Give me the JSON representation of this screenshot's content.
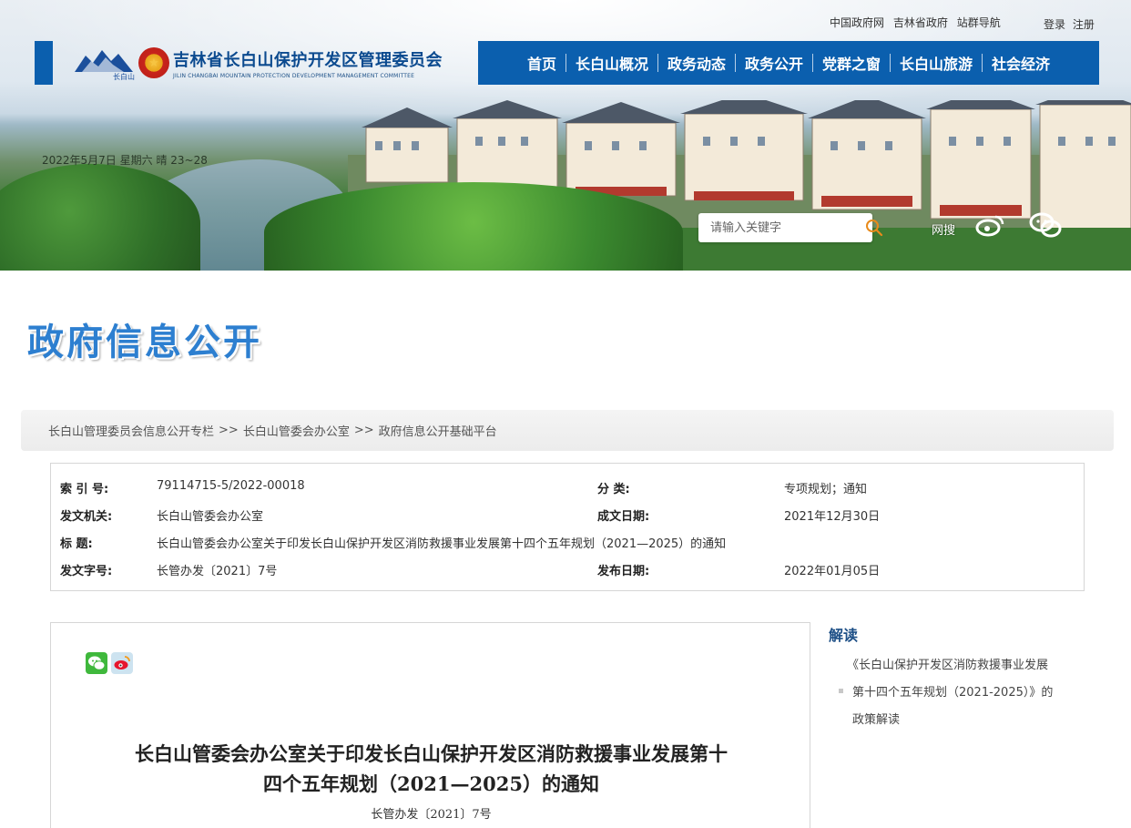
{
  "header": {
    "top_links": [
      "中国政府网",
      "吉林省政府",
      "站群导航"
    ],
    "auth_links": [
      "登录",
      "注册"
    ],
    "site_title": "吉林省长白山保护开发区管理委员会",
    "site_subtitle": "JILIN CHANGBAI MOUNTAIN PROTECTION DEVELOPMENT MANAGEMENT COMMITTEE",
    "logo_text": "长白山",
    "nav": [
      "首页",
      "长白山概况",
      "政务动态",
      "政务公开",
      "党群之窗",
      "长白山旅游",
      "社会经济"
    ],
    "date_text": "2022年5月7日 星期六 晴 23~28",
    "search_placeholder": "请输入关键字",
    "wangsou_label": "网搜",
    "accent_color": "#0b5fae"
  },
  "section_title": "政府信息公开",
  "breadcrumb": [
    "长白山管理委员会信息公开专栏",
    "长白山管委会办公室",
    "政府信息公开基础平台"
  ],
  "breadcrumb_sep": ">>",
  "meta": {
    "index_label": "索 引 号:",
    "index_value": "79114715-5/2022-00018",
    "category_label": "分    类:",
    "category_value": "专项规划；通知",
    "issuer_label": "发文机关:",
    "issuer_value": "长白山管委会办公室",
    "created_label": "成文日期:",
    "created_value": "2021年12月30日",
    "title_label": "标      题:",
    "title_value": "长白山管委会办公室关于印发长白山保护开发区消防救援事业发展第十四个五年规划（2021—2025）的通知",
    "docno_label": "发文字号:",
    "docno_value": "长管办发〔2021〕7号",
    "published_label": "发布日期:",
    "published_value": "2022年01月05日"
  },
  "article": {
    "title_line1": "长白山管委会办公室关于印发长白山保护开发区消防救援事业发展第十",
    "title_line2": "四个五年规划（2021—2025）的通知",
    "doc_number": "长管办发〔2021〕7号"
  },
  "sidebar": {
    "title": "解读",
    "item_line1": "《长白山保护开发区消防救援事业发展",
    "item_line2": "第十四个五年规划（2021-2025）》的",
    "item_line3": "政策解读"
  }
}
